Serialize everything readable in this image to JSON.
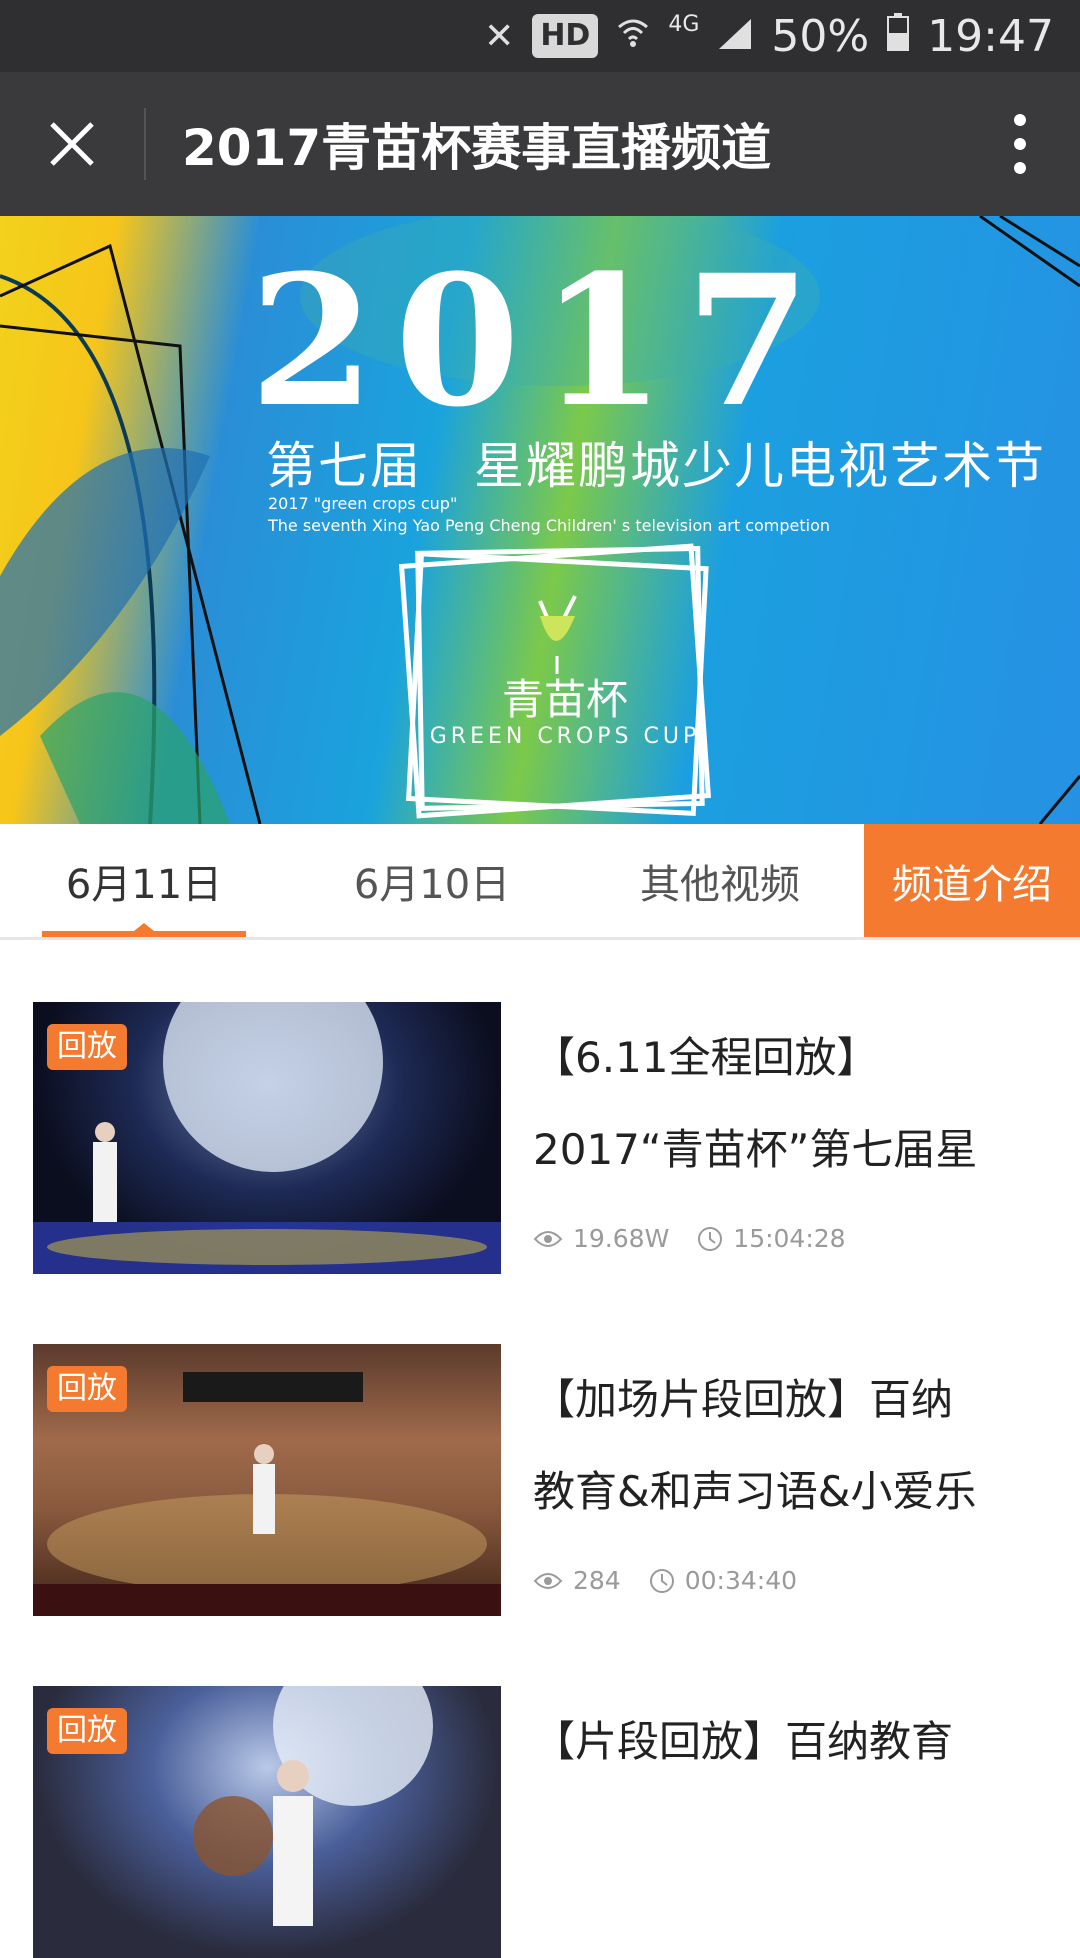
{
  "status_bar": {
    "hd": "HD",
    "network": "4G",
    "battery": "50%",
    "time": "19:47"
  },
  "app_bar": {
    "title": "2017青苗杯赛事直播频道"
  },
  "banner": {
    "year": "2017",
    "title_cn": "第七届　星耀鹏城少儿电视艺术节",
    "subtitle_en_1": "2017 \"green crops cup\"",
    "subtitle_en_2": "The seventh Xing Yao Peng Cheng Children' s television art competion",
    "cup_cn": "青苗杯",
    "cup_en": "GREEN CROPS CUP"
  },
  "tabs": [
    {
      "label": "6月11日",
      "active": true
    },
    {
      "label": "6月10日",
      "active": false
    },
    {
      "label": "其他视频",
      "active": false
    }
  ],
  "intro_tab": {
    "label": "频道介绍"
  },
  "videos": [
    {
      "badge": "回放",
      "title_line1": "【6.11全程回放】",
      "title_line2": "2017“青苗杯”第七届星",
      "views": "19.68W",
      "duration": "15:04:28"
    },
    {
      "badge": "回放",
      "title_line1": "【加场片段回放】百纳",
      "title_line2": "教育&和声习语&小爱乐",
      "views": "284",
      "duration": "00:34:40"
    },
    {
      "badge": "回放",
      "title_line1": "【片段回放】百纳教育",
      "title_line2": "",
      "views": "",
      "duration": ""
    }
  ],
  "colors": {
    "accent": "#f47a2f",
    "app_bar": "#3a3a3c",
    "status_bar": "#2f2f31"
  },
  "icons": {
    "close": "close-icon",
    "more": "more-vertical-icon",
    "views": "eye-icon",
    "duration": "clock-icon"
  }
}
